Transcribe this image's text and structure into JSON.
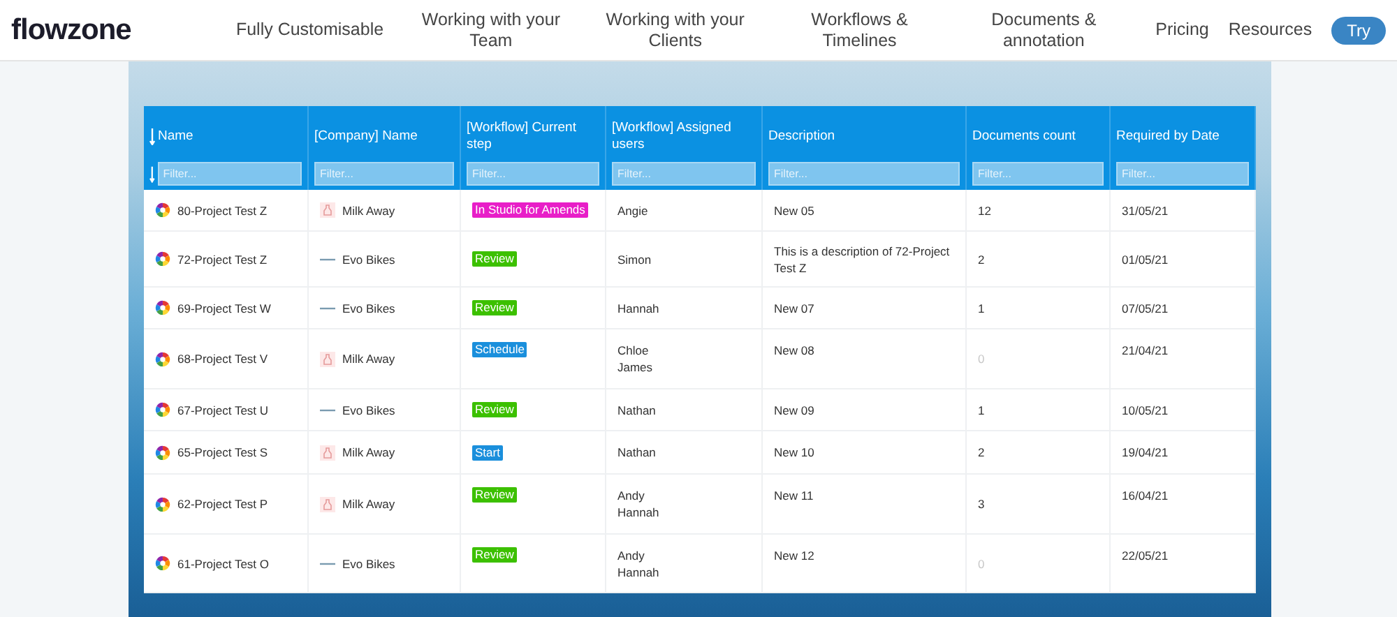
{
  "brand": {
    "name": "flowzone"
  },
  "nav": [
    "Fully Customisable",
    "Working with your Team",
    "Working with your Clients",
    "Workflows & Timelines",
    "Documents & annotation"
  ],
  "nav_right": [
    "Pricing",
    "Resources"
  ],
  "cta": "Try",
  "table": {
    "columns": [
      {
        "label": "Name",
        "placeholder": "Filter...",
        "sortable": true
      },
      {
        "label": "[Company] Name",
        "placeholder": "Filter...",
        "sortable": false
      },
      {
        "label": "[Workflow] Current step",
        "placeholder": "Filter...",
        "sortable": false
      },
      {
        "label": "[Workflow] Assigned users",
        "placeholder": "Filter...",
        "sortable": false
      },
      {
        "label": "Description",
        "placeholder": "Filter...",
        "sortable": false
      },
      {
        "label": "Documents count",
        "placeholder": "Filter...",
        "sortable": false
      },
      {
        "label": "Required by Date",
        "placeholder": "Filter...",
        "sortable": false
      }
    ],
    "rows": [
      {
        "name": "80-Project Test Z",
        "company": {
          "name": "Milk Away",
          "kind": "milk"
        },
        "step": {
          "label": "In Studio for Amends",
          "color": "#e81ec8"
        },
        "users": [
          "Angie"
        ],
        "description": "New 05",
        "documents": "12",
        "documents_dimmed": false,
        "date": "31/05/21"
      },
      {
        "name": "72-Project Test Z",
        "company": {
          "name": "Evo Bikes",
          "kind": "bikes"
        },
        "step": {
          "label": "Review",
          "color": "#3cc000"
        },
        "users": [
          "Simon"
        ],
        "description": "This is a description of 72-Project Test Z",
        "documents": "2",
        "documents_dimmed": false,
        "date": "01/05/21"
      },
      {
        "name": "69-Project Test W",
        "company": {
          "name": "Evo Bikes",
          "kind": "bikes"
        },
        "step": {
          "label": "Review",
          "color": "#3cc000"
        },
        "users": [
          "Hannah"
        ],
        "description": "New 07",
        "documents": "1",
        "documents_dimmed": false,
        "date": "07/05/21"
      },
      {
        "name": "68-Project Test V",
        "company": {
          "name": "Milk Away",
          "kind": "milk"
        },
        "step": {
          "label": "Schedule",
          "color": "#1a8fdc"
        },
        "users": [
          "Chloe",
          "James"
        ],
        "description": "New 08",
        "documents": "0",
        "documents_dimmed": true,
        "date": "21/04/21"
      },
      {
        "name": "67-Project Test U",
        "company": {
          "name": "Evo Bikes",
          "kind": "bikes"
        },
        "step": {
          "label": "Review",
          "color": "#3cc000"
        },
        "users": [
          "Nathan"
        ],
        "description": "New 09",
        "documents": "1",
        "documents_dimmed": false,
        "date": "10/05/21"
      },
      {
        "name": "65-Project Test S",
        "company": {
          "name": "Milk Away",
          "kind": "milk"
        },
        "step": {
          "label": "Start",
          "color": "#1a8fdc"
        },
        "users": [
          "Nathan"
        ],
        "description": "New 10",
        "documents": "2",
        "documents_dimmed": false,
        "date": "19/04/21"
      },
      {
        "name": "62-Project Test P",
        "company": {
          "name": "Milk Away",
          "kind": "milk"
        },
        "step": {
          "label": "Review",
          "color": "#3cc000"
        },
        "users": [
          "Andy",
          "Hannah"
        ],
        "description": "New 11",
        "documents": "3",
        "documents_dimmed": false,
        "date": "16/04/21"
      },
      {
        "name": "61-Project Test O",
        "company": {
          "name": "Evo Bikes",
          "kind": "bikes"
        },
        "step": {
          "label": "Review",
          "color": "#3cc000"
        },
        "users": [
          "Andy",
          "Hannah"
        ],
        "description": "New 12",
        "documents": "0",
        "documents_dimmed": true,
        "date": "22/05/21"
      }
    ]
  }
}
